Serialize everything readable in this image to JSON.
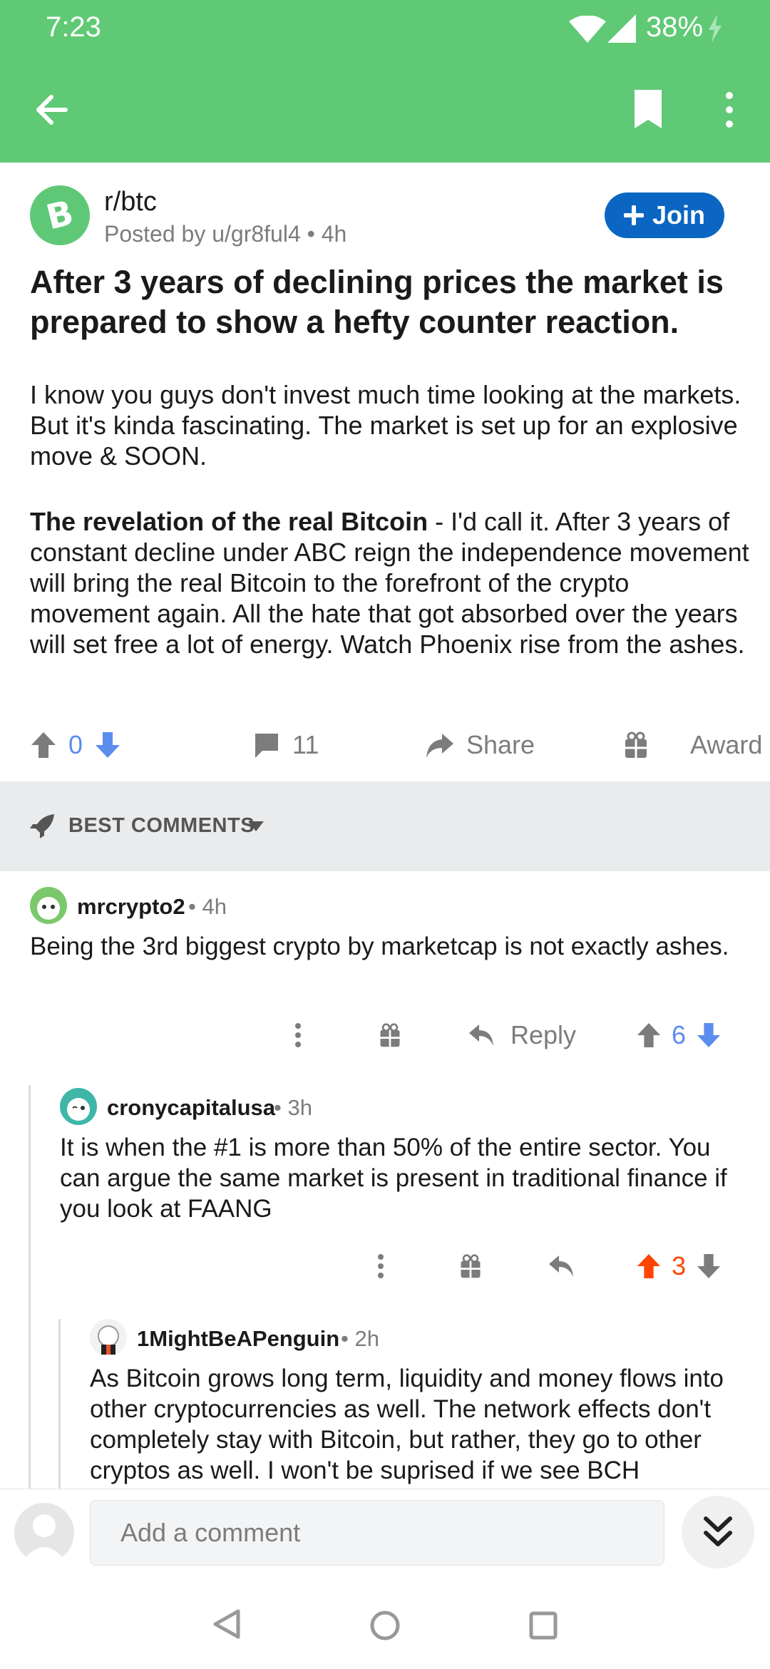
{
  "status_bar": {
    "time": "7:23",
    "battery": "38%"
  },
  "post": {
    "subreddit": "r/btc",
    "posted_by": "Posted by u/gr8ful4",
    "age": "4h",
    "join_label": "Join",
    "title": "After 3 years of declining prices the market is prepared to show a hefty counter reaction.",
    "paragraph1": "I know you guys don't invest much time looking at the markets. But it's kinda fascinating. The market is set up for an explosive move & SOON.",
    "paragraph2_bold": "The revelation of the real Bitcoin",
    "paragraph2_rest": " - I'd call it. After 3 years of constant decline under ABC reign the independence movement will bring the real Bitcoin to the forefront of the crypto movement again. All the hate that got absorbed over the years will set free a lot of energy. Watch Phoenix rise from the ashes.",
    "votes": "0",
    "comment_count": "11",
    "share_label": "Share",
    "award_label": "Award"
  },
  "sort": {
    "label": "BEST COMMENTS"
  },
  "comments": [
    {
      "user": "mrcrypto2",
      "age": "4h",
      "text": "Being the 3rd biggest crypto by marketcap is not exactly ashes.",
      "reply_label": "Reply",
      "votes": "6"
    },
    {
      "user": "cronycapitalusa",
      "age": "3h",
      "text": "It is when the #1 is more than 50% of the entire sector. You can argue the same market is present in traditional finance if you look at FAANG",
      "votes": "3"
    },
    {
      "user": "1MightBeAPenguin",
      "age": "2h",
      "text": "As Bitcoin grows long term, liquidity and money flows into other cryptocurrencies as well. The network effects don't completely stay with Bitcoin, but rather, they go to other cryptos as well. I won't be suprised if we see BCH"
    }
  ],
  "composer": {
    "placeholder": "Add a comment"
  },
  "colors": {
    "header": "#60c975",
    "join": "#0a66c2",
    "upvoted": "#ff4500",
    "vote_blue": "#5b8def"
  },
  "icons": [
    "back-arrow-icon",
    "bookmark-icon",
    "more-vert-icon",
    "bitcoin-cash-icon",
    "plus-icon",
    "upvote-icon",
    "downvote-icon",
    "comment-icon",
    "share-icon",
    "gift-icon",
    "rocket-icon",
    "chevron-down-icon",
    "reply-icon",
    "avatar-icon",
    "double-chevron-down-icon",
    "nav-back-icon",
    "nav-home-icon",
    "nav-recents-icon"
  ]
}
